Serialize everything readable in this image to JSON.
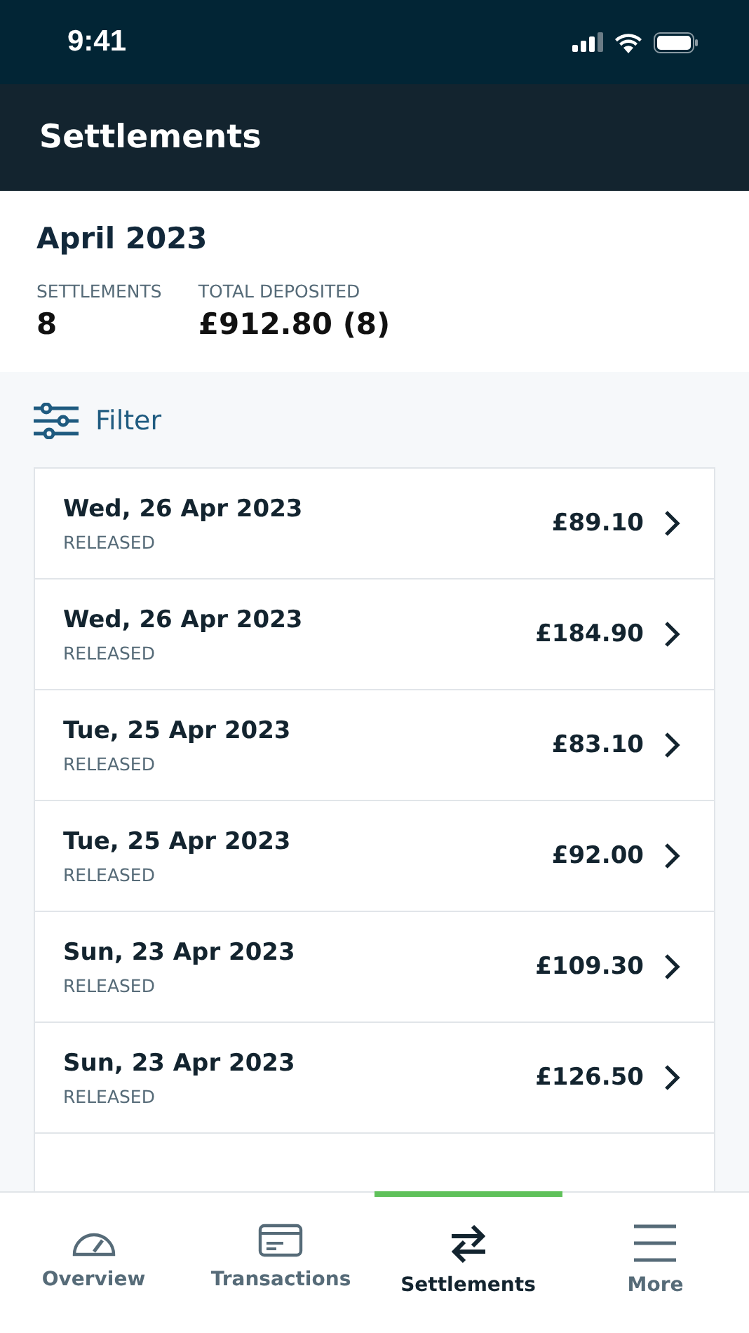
{
  "status_bar": {
    "time": "9:41"
  },
  "header": {
    "title": "Settlements"
  },
  "summary": {
    "period": "April 2023",
    "stats": [
      {
        "label": "SETTLEMENTS",
        "value": "8"
      },
      {
        "label": "TOTAL DEPOSITED",
        "value": "£912.80 (8)"
      }
    ]
  },
  "filter": {
    "label": "Filter"
  },
  "settlements": [
    {
      "date": "Wed, 26 Apr 2023",
      "status": "RELEASED",
      "amount": "£89.10"
    },
    {
      "date": "Wed, 26 Apr 2023",
      "status": "RELEASED",
      "amount": "£184.90"
    },
    {
      "date": "Tue, 25 Apr 2023",
      "status": "RELEASED",
      "amount": "£83.10"
    },
    {
      "date": "Tue, 25 Apr 2023",
      "status": "RELEASED",
      "amount": "£92.00"
    },
    {
      "date": "Sun, 23 Apr 2023",
      "status": "RELEASED",
      "amount": "£109.30"
    },
    {
      "date": "Sun, 23 Apr 2023",
      "status": "RELEASED",
      "amount": "£126.50"
    }
  ],
  "tab_bar": [
    {
      "label": "Overview",
      "kind": "gauge",
      "selected": false
    },
    {
      "label": "Transactions",
      "kind": "card",
      "selected": false
    },
    {
      "label": "Settlements",
      "kind": "arrows",
      "selected": true
    },
    {
      "label": "More",
      "kind": "menu",
      "selected": false
    }
  ]
}
